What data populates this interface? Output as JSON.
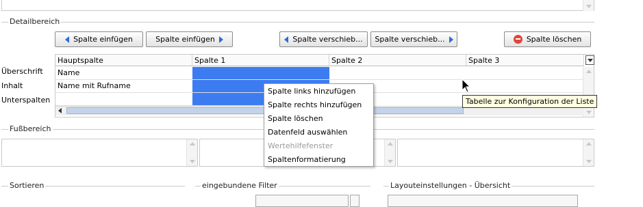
{
  "sections": {
    "detail": "Detailbereich",
    "footer": "Fußbereich",
    "sort": "Sortieren",
    "filters": "eingebundene Filter",
    "layout": "Layouteinstellungen - Übersicht"
  },
  "toolbar": {
    "insert_left": "Spalte einfügen",
    "insert_right": "Spalte einfügen",
    "move_left": "Spalte verschieb...",
    "move_right": "Spalte verschieb...",
    "delete": "Spalte löschen"
  },
  "grid": {
    "columns": [
      "Hauptspalte",
      "Spalte 1",
      "Spalte 2",
      "Spalte 3"
    ],
    "row_labels": [
      "Überschrift",
      "Inhalt",
      "Unterspalten"
    ],
    "rows": [
      [
        "Name",
        "",
        "",
        ""
      ],
      [
        "Name mit Rufname",
        "",
        "",
        ""
      ]
    ]
  },
  "context_menu": {
    "items": [
      {
        "label": "Spalte links hinzufügen",
        "enabled": true
      },
      {
        "label": "Spalte rechts hinzufügen",
        "enabled": true
      },
      {
        "label": "Spalte löschen",
        "enabled": true
      },
      {
        "label": "Datenfeld auswählen",
        "enabled": true
      },
      {
        "label": "Wertehilfefenster",
        "enabled": false
      },
      {
        "label": "Spaltenformatierung",
        "enabled": true
      }
    ]
  },
  "tooltip": "Tabelle zur Konfiguration der Liste",
  "colors": {
    "selection": "#3d7cf0",
    "button_arrow": "#2d6bd6",
    "delete_icon": "#e0463b",
    "tooltip_bg": "#ffffe1"
  }
}
